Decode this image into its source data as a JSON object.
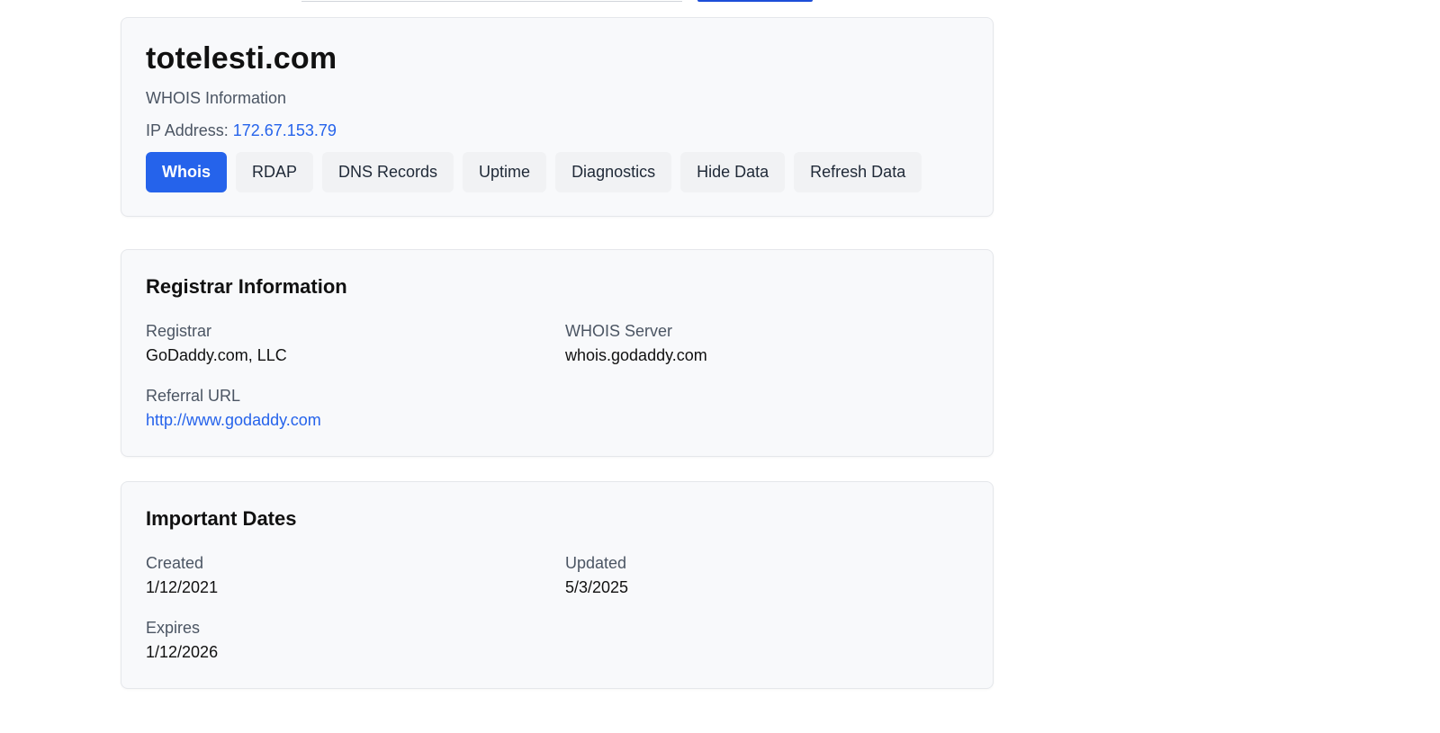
{
  "domain": {
    "title": "totelesti.com",
    "subtitle": "WHOIS Information",
    "ip_label": "IP Address:",
    "ip_value": "172.67.153.79"
  },
  "tabs": [
    {
      "label": "Whois",
      "active": true
    },
    {
      "label": "RDAP",
      "active": false
    },
    {
      "label": "DNS Records",
      "active": false
    },
    {
      "label": "Uptime",
      "active": false
    },
    {
      "label": "Diagnostics",
      "active": false
    },
    {
      "label": "Hide Data",
      "active": false
    },
    {
      "label": "Refresh Data",
      "active": false
    }
  ],
  "registrar": {
    "title": "Registrar Information",
    "registrar_label": "Registrar",
    "registrar_value": "GoDaddy.com, LLC",
    "whois_server_label": "WHOIS Server",
    "whois_server_value": "whois.godaddy.com",
    "referral_label": "Referral URL",
    "referral_value": "http://www.godaddy.com"
  },
  "dates": {
    "title": "Important Dates",
    "created_label": "Created",
    "created_value": "1/12/2021",
    "updated_label": "Updated",
    "updated_value": "5/3/2025",
    "expires_label": "Expires",
    "expires_value": "1/12/2026"
  },
  "colors": {
    "accent": "#2563eb",
    "card_bg": "#f8f9fb",
    "tab_bg": "#f1f2f4"
  }
}
